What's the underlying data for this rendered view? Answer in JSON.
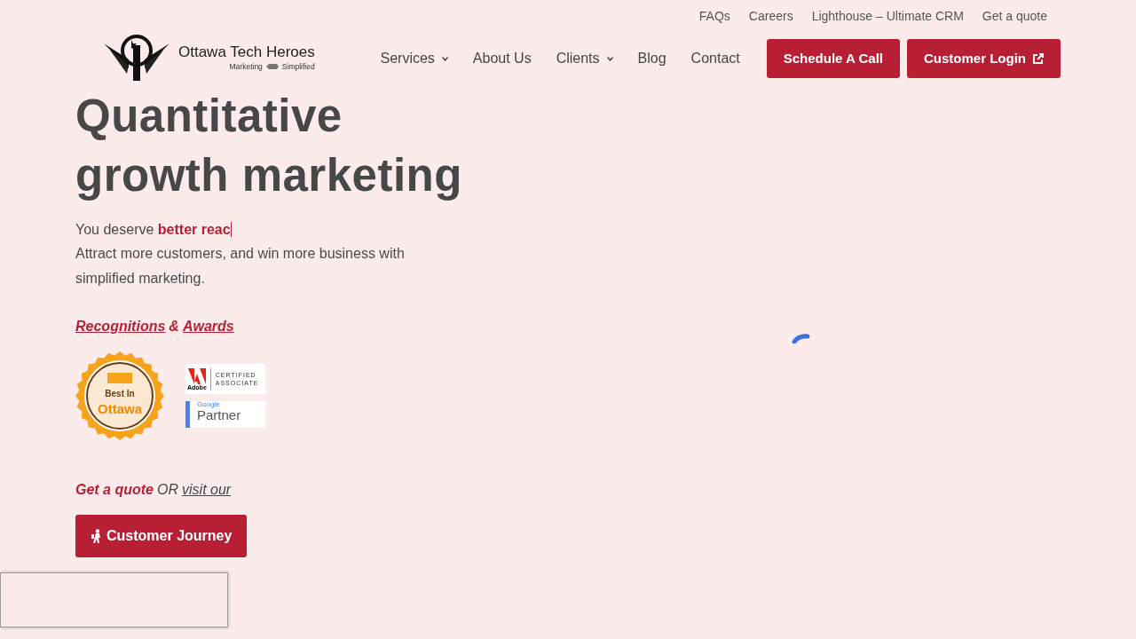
{
  "top_links": [
    "FAQs",
    "Careers",
    "Lighthouse – Ultimate CRM",
    "Get a quote"
  ],
  "logo": {
    "name": "Ottawa Tech Heroes",
    "tagline_left": "Marketing",
    "tagline_right": "Simplified"
  },
  "nav": [
    {
      "label": "Services",
      "dropdown": true
    },
    {
      "label": "About Us",
      "dropdown": false
    },
    {
      "label": "Clients",
      "dropdown": true
    },
    {
      "label": "Blog",
      "dropdown": false
    },
    {
      "label": "Contact",
      "dropdown": false
    }
  ],
  "nav_buttons": [
    {
      "label": "Schedule A Call",
      "external": false
    },
    {
      "label": "Customer Login",
      "external": true
    }
  ],
  "hero": {
    "title": "Quantitative growth marketing",
    "lead": "You deserve **better reac**",
    "typing_cursor": true,
    "text": "Attract more customers, and win more business with simplified marketing.",
    "recognitions": {
      "first": "Recognitions",
      "joiner": "&",
      "second": "Awards"
    },
    "badges": [
      {
        "kind": "seal",
        "line_1": "Best In",
        "line_2": "Ottawa"
      },
      {
        "kind": "adobe",
        "line_1": "Adobe",
        "line_2": "CERTIFIED",
        "line_3": "ASSOCIATE"
      },
      {
        "kind": "google",
        "line_1": "Google",
        "line_2": "Partner"
      }
    ],
    "cta": {
      "quote": "Get a quote",
      "joiner": "OR",
      "visit": "visit our",
      "button": "Customer Journey"
    }
  },
  "loading": true
}
